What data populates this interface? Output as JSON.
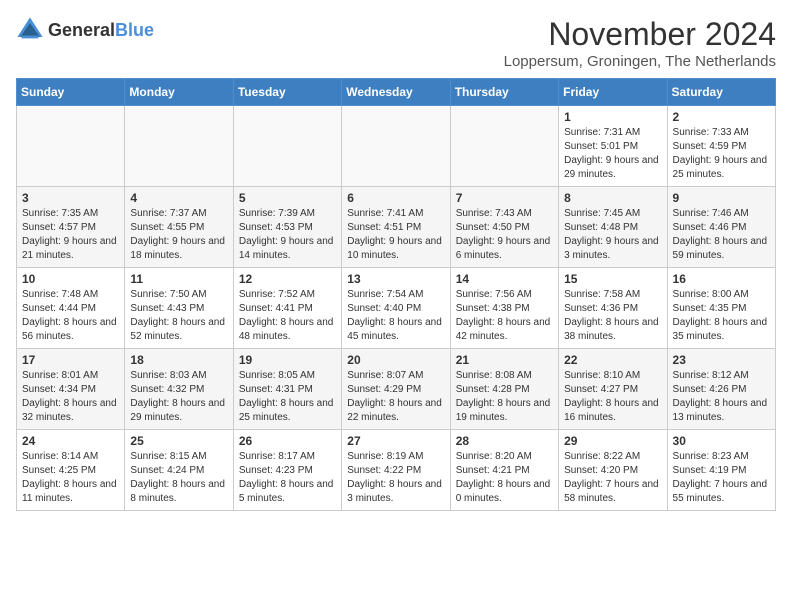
{
  "header": {
    "logo_general": "General",
    "logo_blue": "Blue",
    "month_title": "November 2024",
    "location": "Loppersum, Groningen, The Netherlands"
  },
  "columns": [
    "Sunday",
    "Monday",
    "Tuesday",
    "Wednesday",
    "Thursday",
    "Friday",
    "Saturday"
  ],
  "weeks": [
    [
      {
        "day": "",
        "info": ""
      },
      {
        "day": "",
        "info": ""
      },
      {
        "day": "",
        "info": ""
      },
      {
        "day": "",
        "info": ""
      },
      {
        "day": "",
        "info": ""
      },
      {
        "day": "1",
        "info": "Sunrise: 7:31 AM\nSunset: 5:01 PM\nDaylight: 9 hours and 29 minutes."
      },
      {
        "day": "2",
        "info": "Sunrise: 7:33 AM\nSunset: 4:59 PM\nDaylight: 9 hours and 25 minutes."
      }
    ],
    [
      {
        "day": "3",
        "info": "Sunrise: 7:35 AM\nSunset: 4:57 PM\nDaylight: 9 hours and 21 minutes."
      },
      {
        "day": "4",
        "info": "Sunrise: 7:37 AM\nSunset: 4:55 PM\nDaylight: 9 hours and 18 minutes."
      },
      {
        "day": "5",
        "info": "Sunrise: 7:39 AM\nSunset: 4:53 PM\nDaylight: 9 hours and 14 minutes."
      },
      {
        "day": "6",
        "info": "Sunrise: 7:41 AM\nSunset: 4:51 PM\nDaylight: 9 hours and 10 minutes."
      },
      {
        "day": "7",
        "info": "Sunrise: 7:43 AM\nSunset: 4:50 PM\nDaylight: 9 hours and 6 minutes."
      },
      {
        "day": "8",
        "info": "Sunrise: 7:45 AM\nSunset: 4:48 PM\nDaylight: 9 hours and 3 minutes."
      },
      {
        "day": "9",
        "info": "Sunrise: 7:46 AM\nSunset: 4:46 PM\nDaylight: 8 hours and 59 minutes."
      }
    ],
    [
      {
        "day": "10",
        "info": "Sunrise: 7:48 AM\nSunset: 4:44 PM\nDaylight: 8 hours and 56 minutes."
      },
      {
        "day": "11",
        "info": "Sunrise: 7:50 AM\nSunset: 4:43 PM\nDaylight: 8 hours and 52 minutes."
      },
      {
        "day": "12",
        "info": "Sunrise: 7:52 AM\nSunset: 4:41 PM\nDaylight: 8 hours and 48 minutes."
      },
      {
        "day": "13",
        "info": "Sunrise: 7:54 AM\nSunset: 4:40 PM\nDaylight: 8 hours and 45 minutes."
      },
      {
        "day": "14",
        "info": "Sunrise: 7:56 AM\nSunset: 4:38 PM\nDaylight: 8 hours and 42 minutes."
      },
      {
        "day": "15",
        "info": "Sunrise: 7:58 AM\nSunset: 4:36 PM\nDaylight: 8 hours and 38 minutes."
      },
      {
        "day": "16",
        "info": "Sunrise: 8:00 AM\nSunset: 4:35 PM\nDaylight: 8 hours and 35 minutes."
      }
    ],
    [
      {
        "day": "17",
        "info": "Sunrise: 8:01 AM\nSunset: 4:34 PM\nDaylight: 8 hours and 32 minutes."
      },
      {
        "day": "18",
        "info": "Sunrise: 8:03 AM\nSunset: 4:32 PM\nDaylight: 8 hours and 29 minutes."
      },
      {
        "day": "19",
        "info": "Sunrise: 8:05 AM\nSunset: 4:31 PM\nDaylight: 8 hours and 25 minutes."
      },
      {
        "day": "20",
        "info": "Sunrise: 8:07 AM\nSunset: 4:29 PM\nDaylight: 8 hours and 22 minutes."
      },
      {
        "day": "21",
        "info": "Sunrise: 8:08 AM\nSunset: 4:28 PM\nDaylight: 8 hours and 19 minutes."
      },
      {
        "day": "22",
        "info": "Sunrise: 8:10 AM\nSunset: 4:27 PM\nDaylight: 8 hours and 16 minutes."
      },
      {
        "day": "23",
        "info": "Sunrise: 8:12 AM\nSunset: 4:26 PM\nDaylight: 8 hours and 13 minutes."
      }
    ],
    [
      {
        "day": "24",
        "info": "Sunrise: 8:14 AM\nSunset: 4:25 PM\nDaylight: 8 hours and 11 minutes."
      },
      {
        "day": "25",
        "info": "Sunrise: 8:15 AM\nSunset: 4:24 PM\nDaylight: 8 hours and 8 minutes."
      },
      {
        "day": "26",
        "info": "Sunrise: 8:17 AM\nSunset: 4:23 PM\nDaylight: 8 hours and 5 minutes."
      },
      {
        "day": "27",
        "info": "Sunrise: 8:19 AM\nSunset: 4:22 PM\nDaylight: 8 hours and 3 minutes."
      },
      {
        "day": "28",
        "info": "Sunrise: 8:20 AM\nSunset: 4:21 PM\nDaylight: 8 hours and 0 minutes."
      },
      {
        "day": "29",
        "info": "Sunrise: 8:22 AM\nSunset: 4:20 PM\nDaylight: 7 hours and 58 minutes."
      },
      {
        "day": "30",
        "info": "Sunrise: 8:23 AM\nSunset: 4:19 PM\nDaylight: 7 hours and 55 minutes."
      }
    ]
  ]
}
